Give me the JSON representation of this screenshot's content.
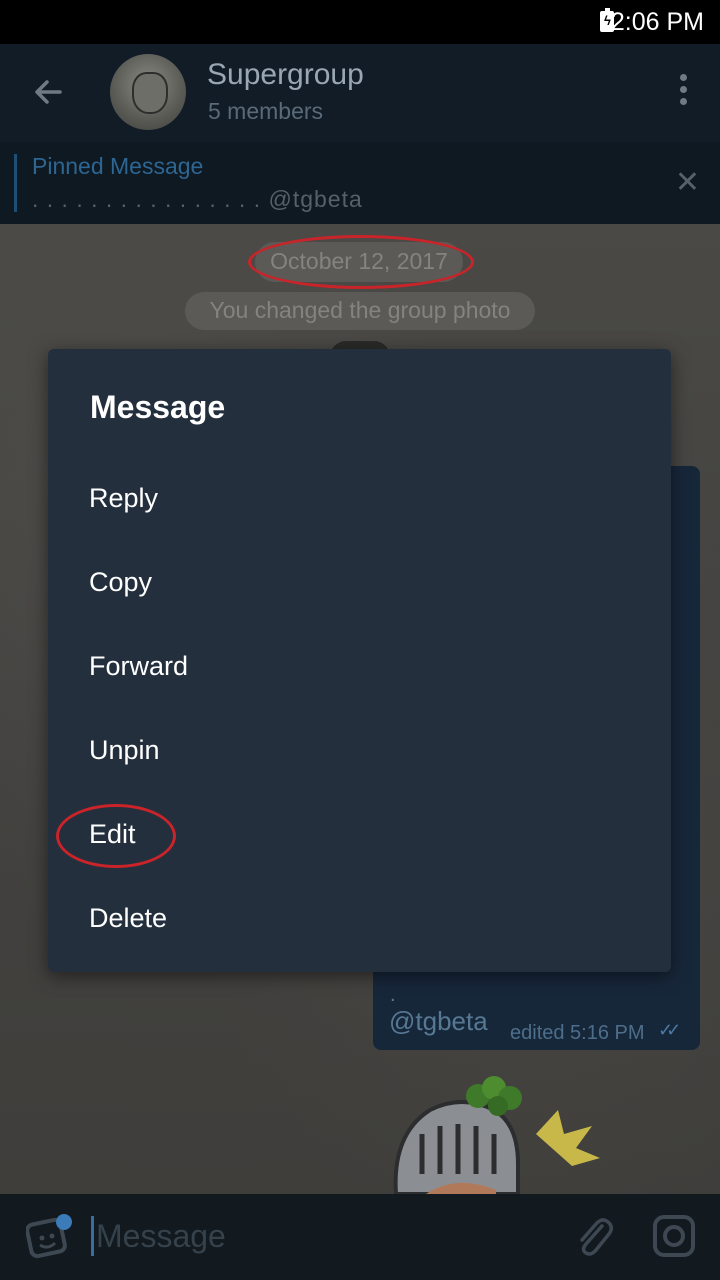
{
  "status_bar": {
    "time": "2:06 PM"
  },
  "header": {
    "title": "Supergroup",
    "subtitle": "5 members"
  },
  "pinned": {
    "title": "Pinned Message",
    "text": ". . . . . . . . . . . . . . . . @tgbeta"
  },
  "chat": {
    "date": "October 12, 2017",
    "service_message": "You changed the group photo",
    "message": {
      "dot": ".",
      "handle": "@tgbeta",
      "meta": "edited 5:16 PM",
      "check": "✓✓"
    }
  },
  "dialog": {
    "title": "Message",
    "items": [
      {
        "label": "Reply"
      },
      {
        "label": "Copy"
      },
      {
        "label": "Forward"
      },
      {
        "label": "Unpin"
      },
      {
        "label": "Edit"
      },
      {
        "label": "Delete"
      }
    ]
  },
  "input": {
    "placeholder": "Message"
  },
  "colors": {
    "accent": "#3a7bb8",
    "highlight_circle": "#c8242a",
    "dialog_bg": "#232f3d"
  }
}
